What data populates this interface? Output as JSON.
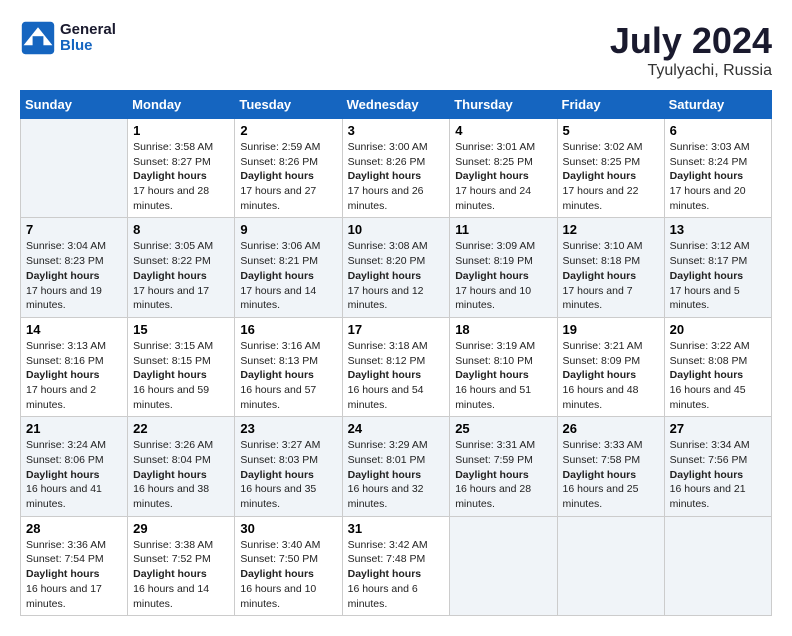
{
  "header": {
    "logo_line1": "General",
    "logo_line2": "Blue",
    "month_year": "July 2024",
    "location": "Tyulyachi, Russia"
  },
  "days_of_week": [
    "Sunday",
    "Monday",
    "Tuesday",
    "Wednesday",
    "Thursday",
    "Friday",
    "Saturday"
  ],
  "weeks": [
    [
      {
        "day": "",
        "sunrise": "",
        "sunset": "",
        "daylight": "",
        "empty": true
      },
      {
        "day": "1",
        "sunrise": "3:58 AM",
        "sunset": "8:27 PM",
        "daylight": "17 hours and 28 minutes."
      },
      {
        "day": "2",
        "sunrise": "2:59 AM",
        "sunset": "8:26 PM",
        "daylight": "17 hours and 27 minutes."
      },
      {
        "day": "3",
        "sunrise": "3:00 AM",
        "sunset": "8:26 PM",
        "daylight": "17 hours and 26 minutes."
      },
      {
        "day": "4",
        "sunrise": "3:01 AM",
        "sunset": "8:25 PM",
        "daylight": "17 hours and 24 minutes."
      },
      {
        "day": "5",
        "sunrise": "3:02 AM",
        "sunset": "8:25 PM",
        "daylight": "17 hours and 22 minutes."
      },
      {
        "day": "6",
        "sunrise": "3:03 AM",
        "sunset": "8:24 PM",
        "daylight": "17 hours and 20 minutes."
      }
    ],
    [
      {
        "day": "7",
        "sunrise": "3:04 AM",
        "sunset": "8:23 PM",
        "daylight": "17 hours and 19 minutes."
      },
      {
        "day": "8",
        "sunrise": "3:05 AM",
        "sunset": "8:22 PM",
        "daylight": "17 hours and 17 minutes."
      },
      {
        "day": "9",
        "sunrise": "3:06 AM",
        "sunset": "8:21 PM",
        "daylight": "17 hours and 14 minutes."
      },
      {
        "day": "10",
        "sunrise": "3:08 AM",
        "sunset": "8:20 PM",
        "daylight": "17 hours and 12 minutes."
      },
      {
        "day": "11",
        "sunrise": "3:09 AM",
        "sunset": "8:19 PM",
        "daylight": "17 hours and 10 minutes."
      },
      {
        "day": "12",
        "sunrise": "3:10 AM",
        "sunset": "8:18 PM",
        "daylight": "17 hours and 7 minutes."
      },
      {
        "day": "13",
        "sunrise": "3:12 AM",
        "sunset": "8:17 PM",
        "daylight": "17 hours and 5 minutes."
      }
    ],
    [
      {
        "day": "14",
        "sunrise": "3:13 AM",
        "sunset": "8:16 PM",
        "daylight": "17 hours and 2 minutes."
      },
      {
        "day": "15",
        "sunrise": "3:15 AM",
        "sunset": "8:15 PM",
        "daylight": "16 hours and 59 minutes."
      },
      {
        "day": "16",
        "sunrise": "3:16 AM",
        "sunset": "8:13 PM",
        "daylight": "16 hours and 57 minutes."
      },
      {
        "day": "17",
        "sunrise": "3:18 AM",
        "sunset": "8:12 PM",
        "daylight": "16 hours and 54 minutes."
      },
      {
        "day": "18",
        "sunrise": "3:19 AM",
        "sunset": "8:10 PM",
        "daylight": "16 hours and 51 minutes."
      },
      {
        "day": "19",
        "sunrise": "3:21 AM",
        "sunset": "8:09 PM",
        "daylight": "16 hours and 48 minutes."
      },
      {
        "day": "20",
        "sunrise": "3:22 AM",
        "sunset": "8:08 PM",
        "daylight": "16 hours and 45 minutes."
      }
    ],
    [
      {
        "day": "21",
        "sunrise": "3:24 AM",
        "sunset": "8:06 PM",
        "daylight": "16 hours and 41 minutes."
      },
      {
        "day": "22",
        "sunrise": "3:26 AM",
        "sunset": "8:04 PM",
        "daylight": "16 hours and 38 minutes."
      },
      {
        "day": "23",
        "sunrise": "3:27 AM",
        "sunset": "8:03 PM",
        "daylight": "16 hours and 35 minutes."
      },
      {
        "day": "24",
        "sunrise": "3:29 AM",
        "sunset": "8:01 PM",
        "daylight": "16 hours and 32 minutes."
      },
      {
        "day": "25",
        "sunrise": "3:31 AM",
        "sunset": "7:59 PM",
        "daylight": "16 hours and 28 minutes."
      },
      {
        "day": "26",
        "sunrise": "3:33 AM",
        "sunset": "7:58 PM",
        "daylight": "16 hours and 25 minutes."
      },
      {
        "day": "27",
        "sunrise": "3:34 AM",
        "sunset": "7:56 PM",
        "daylight": "16 hours and 21 minutes."
      }
    ],
    [
      {
        "day": "28",
        "sunrise": "3:36 AM",
        "sunset": "7:54 PM",
        "daylight": "16 hours and 17 minutes."
      },
      {
        "day": "29",
        "sunrise": "3:38 AM",
        "sunset": "7:52 PM",
        "daylight": "16 hours and 14 minutes."
      },
      {
        "day": "30",
        "sunrise": "3:40 AM",
        "sunset": "7:50 PM",
        "daylight": "16 hours and 10 minutes."
      },
      {
        "day": "31",
        "sunrise": "3:42 AM",
        "sunset": "7:48 PM",
        "daylight": "16 hours and 6 minutes."
      },
      {
        "day": "",
        "sunrise": "",
        "sunset": "",
        "daylight": "",
        "empty": true
      },
      {
        "day": "",
        "sunrise": "",
        "sunset": "",
        "daylight": "",
        "empty": true
      },
      {
        "day": "",
        "sunrise": "",
        "sunset": "",
        "daylight": "",
        "empty": true
      }
    ]
  ]
}
